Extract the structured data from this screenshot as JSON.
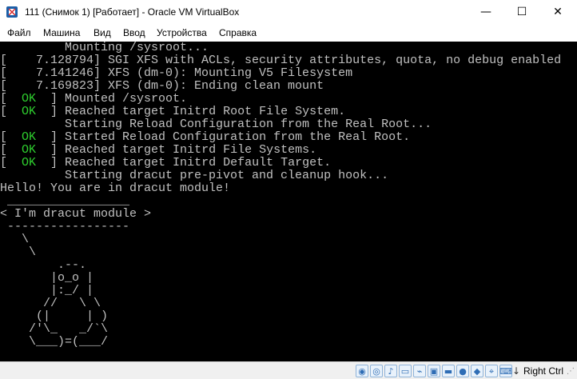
{
  "window": {
    "title": "111 (Снимок 1) [Работает] - Oracle VM VirtualBox",
    "controls": {
      "minimize_label": "—",
      "maximize_label": "☐",
      "close_label": "✕"
    },
    "icon": "virtualbox-icon"
  },
  "menu": {
    "items": [
      {
        "label": "Файл"
      },
      {
        "label": "Машина"
      },
      {
        "label": "Вид"
      },
      {
        "label": "Ввод"
      },
      {
        "label": "Устройства"
      },
      {
        "label": "Справка"
      }
    ]
  },
  "console": {
    "lines": [
      {
        "prefix": "",
        "status": "",
        "suffix": "         Mounting /sysroot..."
      },
      {
        "prefix": "[    7.128794] SGI XFS with ACLs, security attributes, quota, no debug enabled",
        "status": "",
        "suffix": ""
      },
      {
        "prefix": "[    7.141246] XFS (dm-0): Mounting V5 Filesystem",
        "status": "",
        "suffix": ""
      },
      {
        "prefix": "[    7.169823] XFS (dm-0): Ending clean mount",
        "status": "",
        "suffix": ""
      },
      {
        "prefix": "[  ",
        "status": "OK",
        "suffix": "  ] Mounted /sysroot."
      },
      {
        "prefix": "[  ",
        "status": "OK",
        "suffix": "  ] Reached target Initrd Root File System."
      },
      {
        "prefix": "",
        "status": "",
        "suffix": "         Starting Reload Configuration from the Real Root..."
      },
      {
        "prefix": "[  ",
        "status": "OK",
        "suffix": "  ] Started Reload Configuration from the Real Root."
      },
      {
        "prefix": "[  ",
        "status": "OK",
        "suffix": "  ] Reached target Initrd File Systems."
      },
      {
        "prefix": "[  ",
        "status": "OK",
        "suffix": "  ] Reached target Initrd Default Target."
      },
      {
        "prefix": "",
        "status": "",
        "suffix": "         Starting dracut pre-pivot and cleanup hook..."
      },
      {
        "prefix": "Hello! You are in dracut module!",
        "status": "",
        "suffix": ""
      },
      {
        "prefix": " _________________",
        "status": "",
        "suffix": ""
      },
      {
        "prefix": "< I'm dracut module >",
        "status": "",
        "suffix": ""
      },
      {
        "prefix": " -----------------",
        "status": "",
        "suffix": ""
      },
      {
        "prefix": "   \\",
        "status": "",
        "suffix": ""
      },
      {
        "prefix": "    \\",
        "status": "",
        "suffix": ""
      },
      {
        "prefix": "        .--.",
        "status": "",
        "suffix": ""
      },
      {
        "prefix": "       |o_o |",
        "status": "",
        "suffix": ""
      },
      {
        "prefix": "       |:_/ |",
        "status": "",
        "suffix": ""
      },
      {
        "prefix": "      //   \\ \\",
        "status": "",
        "suffix": ""
      },
      {
        "prefix": "     (|     | )",
        "status": "",
        "suffix": ""
      },
      {
        "prefix": "    /'\\_   _/`\\",
        "status": "",
        "suffix": ""
      },
      {
        "prefix": "    \\___)=(___/",
        "status": "",
        "suffix": ""
      }
    ]
  },
  "statusbar": {
    "icons": [
      {
        "name": "hard-disk-icon",
        "glyph": "◉"
      },
      {
        "name": "optical-drive-icon",
        "glyph": "◎"
      },
      {
        "name": "audio-icon",
        "glyph": "♪"
      },
      {
        "name": "network-icon",
        "glyph": "▭"
      },
      {
        "name": "usb-icon",
        "glyph": "⌁"
      },
      {
        "name": "shared-folders-icon",
        "glyph": "▣"
      },
      {
        "name": "display-icon",
        "glyph": "▬"
      },
      {
        "name": "video-capture-icon",
        "glyph": "●"
      },
      {
        "name": "virtualization-icon",
        "glyph": "◆"
      },
      {
        "name": "mouse-integration-icon",
        "glyph": "⌖"
      },
      {
        "name": "keyboard-icon",
        "glyph": "⌨"
      },
      {
        "name": "machine-state-icon",
        "glyph": "▶"
      }
    ],
    "arrow": "↓",
    "host_key_label": "Right Ctrl"
  },
  "colors": {
    "console_background": "#000000",
    "console_text": "#c0c0c0",
    "ok_text": "#2ecf2e",
    "statusbar_background": "#f0f0f0"
  }
}
